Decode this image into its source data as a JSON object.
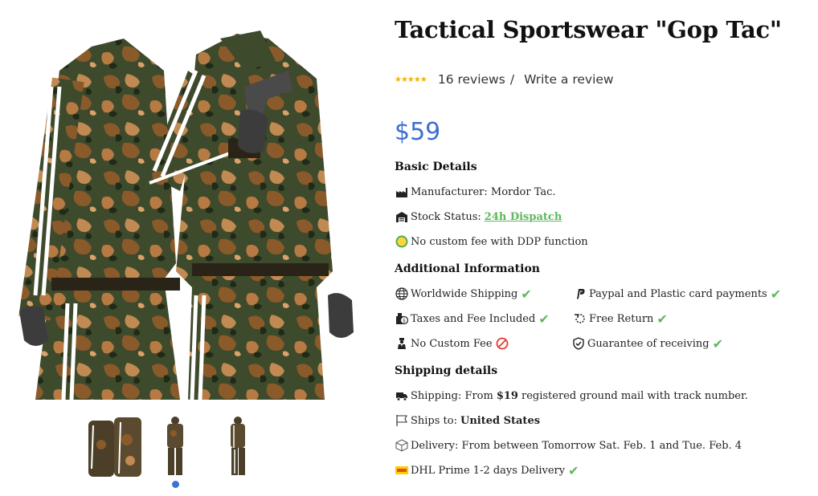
{
  "product": {
    "title": "Tactical Sportswear \"Gop Tac\"",
    "stars": "★★★★★",
    "reviews": "16 reviews",
    "separator": "/",
    "write_review": "Write a review",
    "price": "$59"
  },
  "basic_details": {
    "heading": "Basic Details",
    "manufacturer": "Manufacturer: Mordor Tac.",
    "stock_label": "Stock Status:",
    "stock_value": "24h Dispatch",
    "custom_fee": "No custom fee with DDP function",
    "tax_badge": "TAX"
  },
  "additional_info": {
    "heading": "Additional Information",
    "worldwide_shipping": "Worldwide Shipping",
    "payments": "Paypal and Plastic card payments",
    "taxes": "Taxes and Fee Included",
    "free_return": "Free Return",
    "no_custom_fee": "No Custom Fee",
    "guarantee": "Guarantee of receiving"
  },
  "shipping": {
    "heading": "Shipping details",
    "shipping_prefix": "Shipping: From",
    "shipping_price": "$19",
    "shipping_suffix": "registered ground mail with track number.",
    "ships_to_label": "Ships to:",
    "ships_to_value": "United States",
    "delivery": "Delivery: From between Tomorrow Sat. Feb. 1 and Tue. Feb. 4",
    "dhl": "DHL Prime 1-2 days Delivery"
  },
  "gallery": {
    "active_index": 0,
    "thumbnails": [
      "thumbnail-front-pair",
      "thumbnail-full-body-front",
      "thumbnail-full-body-side"
    ]
  },
  "colors": {
    "price": "#3d6fd0",
    "stars": "#f5b301",
    "check": "#5cb85c",
    "camo_base": "#3e4a2c",
    "camo_brown": "#8a5a2b"
  }
}
